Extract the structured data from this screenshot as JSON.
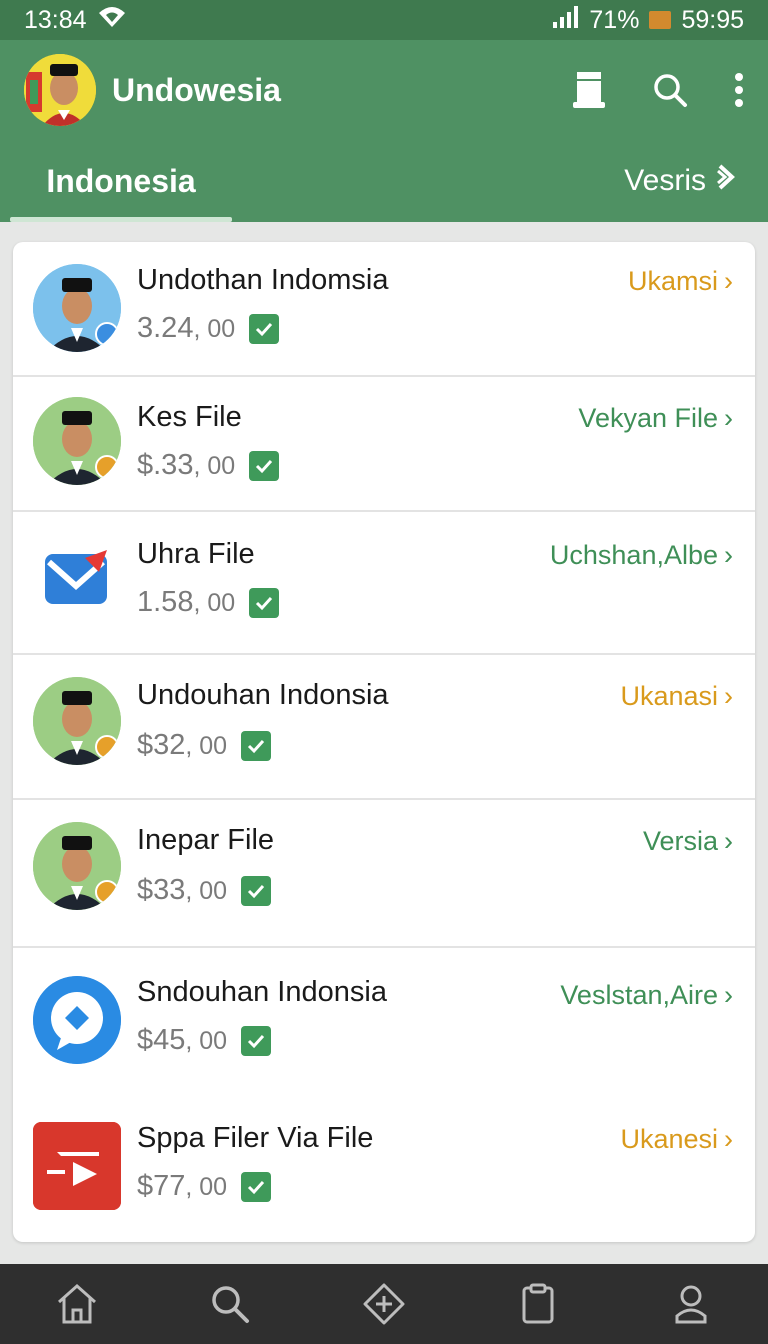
{
  "status": {
    "time": "13:84",
    "battery_text": "71%",
    "clock": "59:95"
  },
  "app": {
    "title": "Undowesia"
  },
  "tabs": {
    "active": "Indonesia",
    "secondary": "Vesris"
  },
  "items": [
    {
      "title": "Undothan Indomsia",
      "price_main": "3.24",
      "price_dec": ", 00",
      "action": "Ukamsi",
      "action_color": "orange",
      "thumb": "avatar",
      "badge": "blue-person-badge"
    },
    {
      "title": "Kes File",
      "price_main": "$.33",
      "price_dec": ", 00",
      "action": "Vekyan File",
      "action_color": "green",
      "thumb": "avatar",
      "badge": "orange-n-badge"
    },
    {
      "title": "Uhra File",
      "price_main": "1.58",
      "price_dec": ", 00",
      "action": "Uchshan,Albe",
      "action_color": "green",
      "thumb": "mail-icon",
      "badge": ""
    },
    {
      "title": "Undouhan Indonsia",
      "price_main": "$32",
      "price_dec": ", 00",
      "action": "Ukanasi",
      "action_color": "orange",
      "thumb": "avatar",
      "badge": "orange-n-badge"
    },
    {
      "title": "Inepar File",
      "price_main": "$33",
      "price_dec": ", 00",
      "action": "Versia",
      "action_color": "green",
      "thumb": "avatar",
      "badge": "orange-n-badge"
    },
    {
      "title": "Sndouhan Indonsia",
      "price_main": "$45",
      "price_dec": ", 00",
      "action": "Veslstan,Aire",
      "action_color": "green",
      "thumb": "chat-bubble-icon",
      "badge": ""
    },
    {
      "title": "Sppa Filer Via File",
      "price_main": "$77",
      "price_dec": ", 00",
      "action": "Ukanesi",
      "action_color": "orange",
      "thumb": "video-file-icon",
      "badge": ""
    }
  ],
  "colors": {
    "app_bar": "#4f9163",
    "status_bar": "#3f7a4f",
    "orange": "#d99a1c",
    "green": "#3f8f57",
    "check": "#3f9a5a"
  },
  "bottom_nav": [
    "home-icon",
    "search-icon",
    "add-icon",
    "clipboard-icon",
    "profile-icon"
  ]
}
